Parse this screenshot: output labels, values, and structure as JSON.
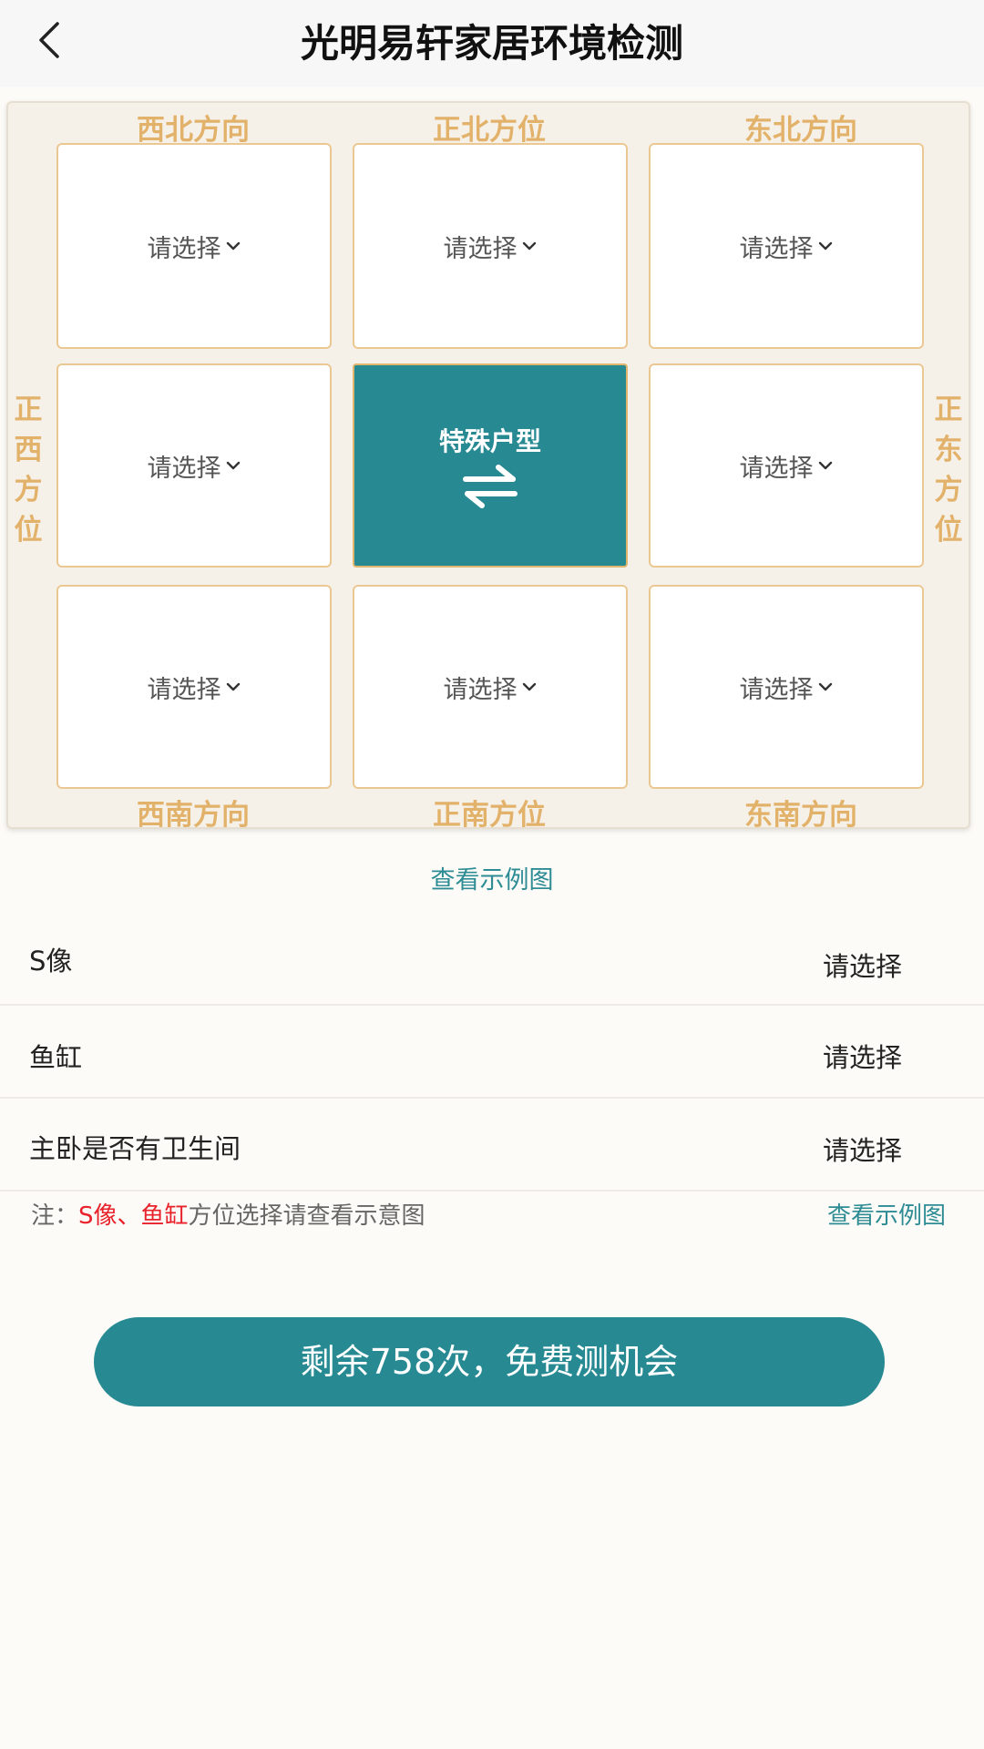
{
  "header": {
    "title": "光明易轩家居环境检测"
  },
  "grid": {
    "directions": {
      "nw": "西北方向",
      "n": "正北方位",
      "ne": "东北方向",
      "w": "正西方位",
      "e": "正东方位",
      "sw": "西南方向",
      "s": "正南方位",
      "se": "东南方向"
    },
    "cells": {
      "nw": "请选择",
      "n": "请选择",
      "ne": "请选择",
      "w": "请选择",
      "e": "请选择",
      "sw": "请选择",
      "s": "请选择",
      "se": "请选择"
    },
    "center": {
      "label": "特殊户型",
      "icon": "swap-arrows-icon"
    }
  },
  "example_link": "查看示例图",
  "rows": [
    {
      "label": "S像",
      "value": "请选择"
    },
    {
      "label": "鱼缸",
      "value": "请选择"
    },
    {
      "label": "主卧是否有卫生间",
      "value": "请选择"
    }
  ],
  "note": {
    "prefix": "注：",
    "highlight": "S像、鱼缸",
    "suffix": "方位选择请查看示意图",
    "link": "查看示例图"
  },
  "cta": {
    "label": "剩余758次，免费测机会"
  },
  "colors": {
    "accent": "#278A93",
    "direction_label": "#E2B26B",
    "cell_border": "#EBC893",
    "highlight": "#E8212A"
  }
}
